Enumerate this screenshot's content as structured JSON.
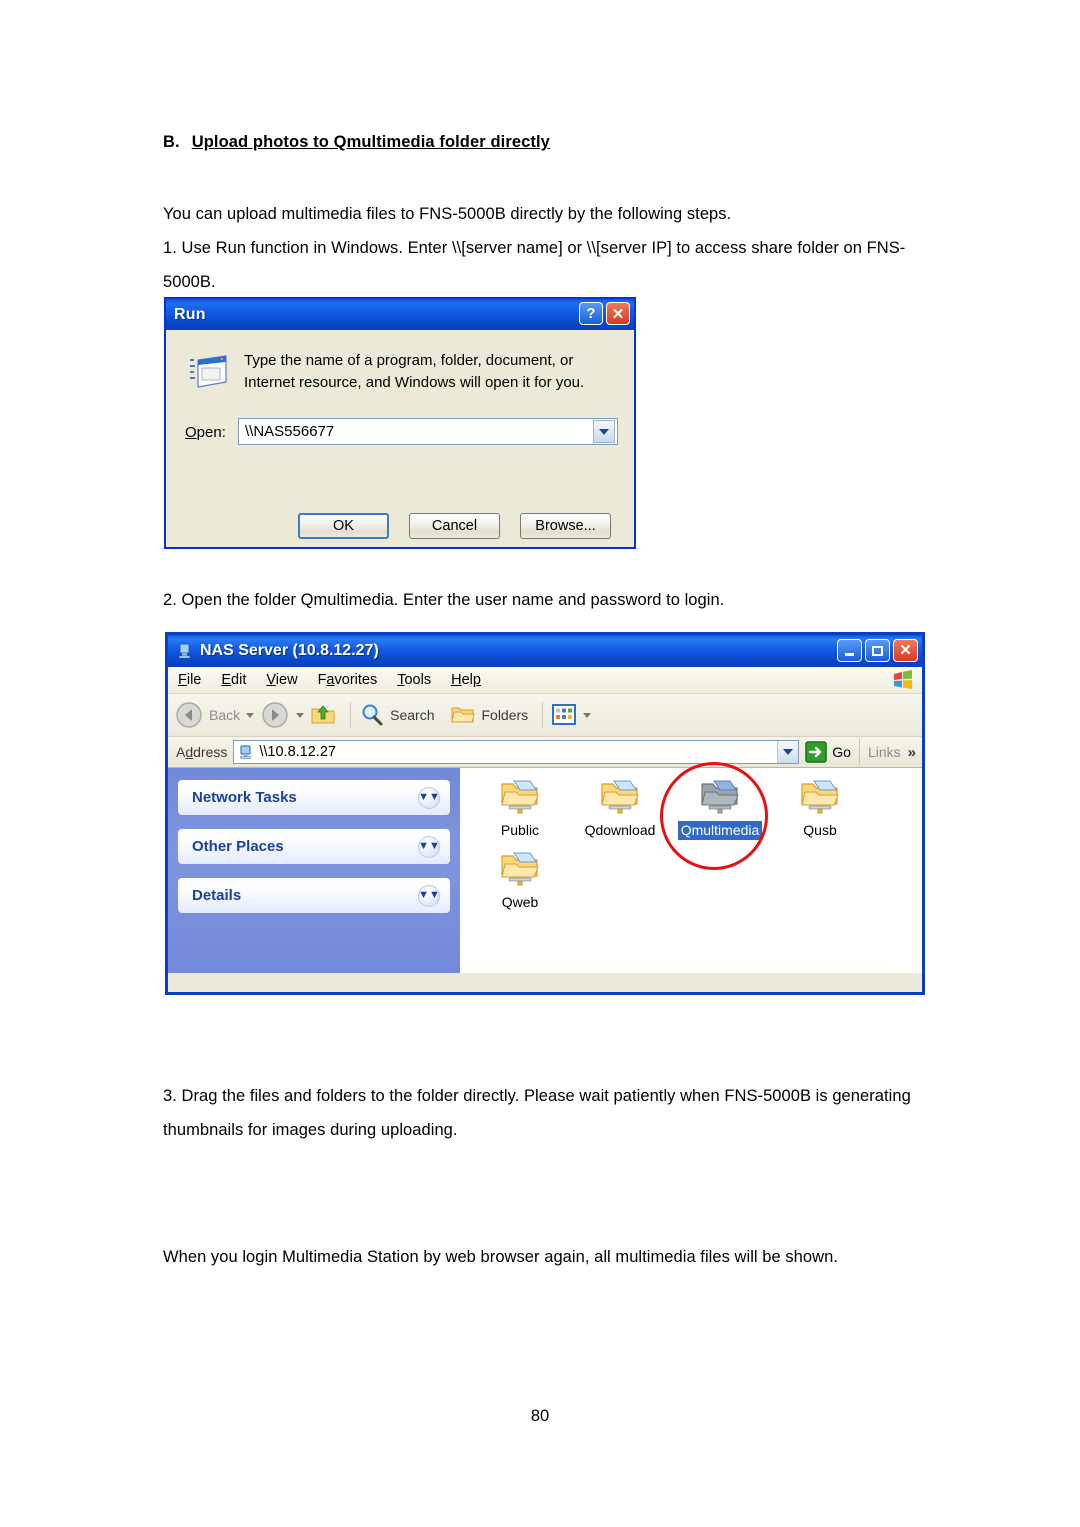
{
  "document": {
    "heading": {
      "lead": "B.",
      "text": "Upload photos to Qmultimedia folder directly"
    },
    "paragraphs": {
      "intro": "You can upload multimedia files to FNS-5000B directly by the following steps.",
      "step1": "1. Use Run function in Windows.  Enter \\\\[server name] or \\\\[server IP] to access share folder on FNS-5000B.",
      "step2": "2. Open the folder Qmultimedia.  Enter the user name and password to login.",
      "step3": "3. Drag the files and folders to the folder directly.  Please wait patiently when FNS-5000B is generating thumbnails for images during uploading.",
      "closing": "When you login Multimedia Station by web browser again, all multimedia files will be shown."
    },
    "page_number": "80"
  },
  "run_dialog": {
    "title": "Run",
    "help_button": "?",
    "close_button": "✕",
    "description": "Type the name of a program, folder, document, or Internet resource, and Windows will open it for you.",
    "open_label": "Open:",
    "open_value": "\\\\NAS556677",
    "buttons": {
      "ok": "OK",
      "cancel": "Cancel",
      "browse": "Browse..."
    }
  },
  "explorer": {
    "title": "NAS Server (10.8.12.27)",
    "window_buttons": {
      "minimize": "minimize",
      "maximize": "maximize",
      "close": "close"
    },
    "menu": [
      {
        "label": "File"
      },
      {
        "label": "Edit"
      },
      {
        "label": "View"
      },
      {
        "label": "Favorites"
      },
      {
        "label": "Tools"
      },
      {
        "label": "Help"
      }
    ],
    "toolbar": {
      "back": "Back",
      "search": "Search",
      "folders": "Folders"
    },
    "address": {
      "label": "Address",
      "value": "\\\\10.8.12.27",
      "go": "Go",
      "links": "Links",
      "links_chevron": "»"
    },
    "sidebar": {
      "panels": [
        {
          "title": "Network Tasks",
          "chevron": "»"
        },
        {
          "title": "Other Places",
          "chevron": "»"
        },
        {
          "title": "Details",
          "chevron": "»"
        }
      ]
    },
    "files": [
      {
        "name": "Public",
        "selected": false
      },
      {
        "name": "Qdownload",
        "selected": false
      },
      {
        "name": "Qmultimedia",
        "selected": true
      },
      {
        "name": "Qusb",
        "selected": false
      },
      {
        "name": "Qweb",
        "selected": false
      }
    ]
  },
  "colors": {
    "title_blue": "#0e56d6",
    "dialog_face": "#ece9d8",
    "sidebar_blue": "#7089d8",
    "selection_blue": "#316ac5",
    "annotation_red": "#e81010"
  }
}
